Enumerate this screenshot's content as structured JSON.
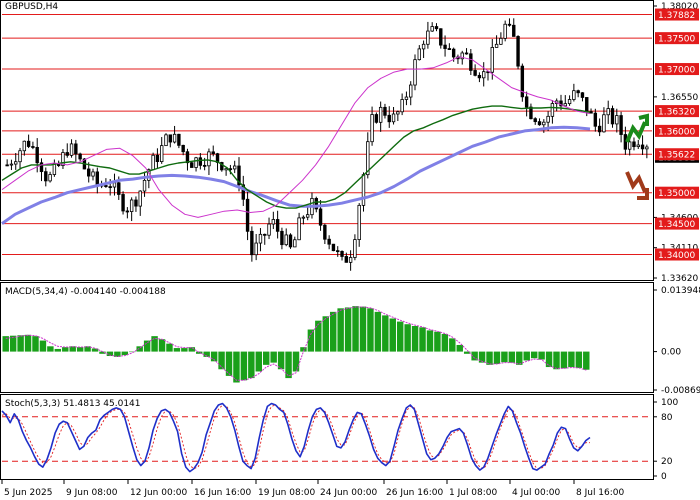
{
  "window": {
    "title": "GBPUSD,H4"
  },
  "colors": {
    "level_line": "#e31b1b",
    "price_tag": "#e31b1b",
    "current_tag": "#000000",
    "candle": "#000000",
    "ma_green": "#0f6b0f",
    "ma_purple": "#8080e6",
    "ma_magenta": "#cc33cc",
    "macd_bar": "#1aa01a",
    "macd_signal": "#cc33cc",
    "stoch_main": "#1f2fc9",
    "stoch_signal": "#e31b1b",
    "arrow_up": "#1a8a1a",
    "arrow_down": "#a03a1a"
  },
  "icons": {
    "up": "up-arrow-icon",
    "down": "down-arrow-icon"
  },
  "chart_data": [
    {
      "type": "line",
      "name": "GBPUSD,H4",
      "y_ticks": [
        "1.38020",
        "1.37882",
        "1.37500",
        "1.37000",
        "1.36550",
        "1.36320",
        "1.36000",
        "1.35581",
        "1.35622",
        "1.35000",
        "1.34600",
        "1.34500",
        "1.34110",
        "1.34000",
        "1.33620"
      ],
      "levels": [
        1.37882,
        1.375,
        1.37,
        1.3632,
        1.36,
        1.35622,
        1.35,
        1.345,
        1.34
      ],
      "current_price": "1.35581",
      "highlighted_levels": [
        "1.37882",
        "1.37500",
        "1.37000",
        "1.36320",
        "1.36000",
        "1.35622",
        "1.35000",
        "1.34500",
        "1.34000"
      ],
      "ylim": [
        1.3362,
        1.3802
      ],
      "close": [
        1.3545,
        1.3565,
        1.3585,
        1.356,
        1.352,
        1.354,
        1.3575,
        1.3555,
        1.353,
        1.351,
        1.352,
        1.349,
        1.3475,
        1.35,
        1.354,
        1.3565,
        1.3595,
        1.3575,
        1.355,
        1.3555,
        1.356,
        1.355,
        1.354,
        1.352,
        1.34,
        1.342,
        1.3455,
        1.343,
        1.3405,
        1.346,
        1.348,
        1.3445,
        1.3415,
        1.3385,
        1.341,
        1.352,
        1.362,
        1.3635,
        1.3618,
        1.364,
        1.37,
        1.375,
        1.376,
        1.374,
        1.372,
        1.3725,
        1.3705,
        1.369,
        1.373,
        1.377,
        1.3745,
        1.364,
        1.3625,
        1.3615,
        1.365,
        1.3645,
        1.366,
        1.364,
        1.3605,
        1.3625,
        1.3615,
        1.3575,
        1.359,
        1.3581
      ],
      "ma_green": [
        1.352,
        1.353,
        1.354,
        1.3545,
        1.3545,
        1.3545,
        1.3548,
        1.355,
        1.3548,
        1.3545,
        1.3542,
        1.354,
        1.3535,
        1.353,
        1.353,
        1.3535,
        1.354,
        1.3545,
        1.3548,
        1.355,
        1.3552,
        1.3553,
        1.355,
        1.354,
        1.352,
        1.3505,
        1.3495,
        1.3485,
        1.3478,
        1.3475,
        1.3475,
        1.348,
        1.3485,
        1.3485,
        1.349,
        1.35,
        1.3515,
        1.353,
        1.3545,
        1.356,
        1.3575,
        1.359,
        1.36,
        1.3605,
        1.3612,
        1.3618,
        1.3625,
        1.363,
        1.3635,
        1.3638,
        1.364,
        1.364,
        1.3638,
        1.3636,
        1.3637,
        1.3637,
        1.3638,
        1.3637,
        1.3635,
        1.3633,
        1.363
      ],
      "ma_purple": [
        1.345,
        1.3465,
        1.3475,
        1.3485,
        1.3492,
        1.35,
        1.3505,
        1.351,
        1.3515,
        1.352,
        1.3522,
        1.3525,
        1.3527,
        1.3528,
        1.3527,
        1.3525,
        1.3522,
        1.3518,
        1.351,
        1.3502,
        1.3495,
        1.3487,
        1.348,
        1.3478,
        1.3478,
        1.348,
        1.3483,
        1.3488,
        1.3493,
        1.35,
        1.351,
        1.3522,
        1.3535,
        1.3545,
        1.3555,
        1.3565,
        1.3575,
        1.3582,
        1.359,
        1.3595,
        1.36,
        1.3602,
        1.3605,
        1.3606,
        1.3605,
        1.3603
      ],
      "ma_magenta": [
        1.3505,
        1.352,
        1.3535,
        1.3545,
        1.3548,
        1.3545,
        1.355,
        1.356,
        1.357,
        1.3572,
        1.356,
        1.354,
        1.3505,
        1.348,
        1.3465,
        1.346,
        1.3465,
        1.347,
        1.3472,
        1.3468,
        1.347,
        1.348,
        1.35,
        1.352,
        1.3545,
        1.3575,
        1.361,
        1.3645,
        1.367,
        1.3685,
        1.3695,
        1.37,
        1.37,
        1.3702,
        1.371,
        1.372,
        1.3715,
        1.37,
        1.3685,
        1.367,
        1.3662,
        1.3655,
        1.365,
        1.364,
        1.3632,
        1.3628
      ]
    },
    {
      "type": "bar",
      "name": "MACD(5,34,4)",
      "values_label": "-0.004140 -0.004188",
      "y_ticks": [
        "0.013948",
        "0.00",
        "-0.008695"
      ],
      "ylim": [
        -0.008695,
        0.013948
      ],
      "values": [
        0.0035,
        0.0036,
        0.0037,
        0.0038,
        0.0035,
        0.0025,
        0.0012,
        0.0006,
        0.001,
        0.0012,
        0.001,
        0.0012,
        0.0007,
        -0.0005,
        -0.001,
        -0.0012,
        -0.0008,
        0.0,
        0.0012,
        0.0025,
        0.0035,
        0.0028,
        0.0018,
        0.0008,
        0.0008,
        0.001,
        -0.0005,
        -0.0012,
        -0.0022,
        -0.004,
        -0.0055,
        -0.007,
        -0.0065,
        -0.006,
        -0.0045,
        -0.003,
        -0.0025,
        -0.004,
        -0.006,
        -0.0045,
        0.001,
        0.005,
        0.007,
        0.008,
        0.009,
        0.0098,
        0.01,
        0.0103,
        0.0102,
        0.0098,
        0.009,
        0.0082,
        0.0075,
        0.0068,
        0.0062,
        0.0058,
        0.0055,
        0.0048,
        0.0045,
        0.004,
        0.003,
        0.0015,
        -0.0005,
        -0.002,
        -0.0025,
        -0.003,
        -0.0028,
        -0.0024,
        -0.0025,
        -0.003,
        -0.002,
        -0.0015,
        -0.0018,
        -0.0035,
        -0.004,
        -0.0038,
        -0.0035,
        -0.0037,
        -0.0041
      ],
      "signal": [
        0.003,
        0.0032,
        0.0035,
        0.0037,
        0.0036,
        0.003,
        0.002,
        0.0012,
        0.001,
        0.0011,
        0.001,
        0.0011,
        0.0008,
        0.0,
        -0.0008,
        -0.0011,
        -0.0009,
        -0.0003,
        0.0008,
        0.002,
        0.003,
        0.0028,
        0.002,
        0.0011,
        0.0009,
        0.0009,
        -0.0002,
        -0.001,
        -0.0018,
        -0.0035,
        -0.005,
        -0.0065,
        -0.0065,
        -0.006,
        -0.005,
        -0.0035,
        -0.0028,
        -0.0038,
        -0.0055,
        -0.0048,
        0.0,
        0.004,
        0.0062,
        0.0075,
        0.0085,
        0.0094,
        0.0098,
        0.0101,
        0.0101,
        0.0099,
        0.0093,
        0.0085,
        0.0078,
        0.0071,
        0.0065,
        0.006,
        0.0056,
        0.005,
        0.0046,
        0.0041,
        0.0033,
        0.002,
        0.0003,
        -0.0015,
        -0.0022,
        -0.0028,
        -0.0028,
        -0.0025,
        -0.0025,
        -0.0028,
        -0.0022,
        -0.0017,
        -0.0018,
        -0.0032,
        -0.0038,
        -0.0038,
        -0.0036,
        -0.0037,
        -0.0042
      ]
    },
    {
      "type": "line",
      "name": "Stoch(5,3,3)",
      "values_label": "51.4813 45.0141",
      "y_ticks": [
        "100",
        "80",
        "20",
        "0"
      ],
      "levels": [
        80,
        20
      ],
      "ylim": [
        0,
        100
      ],
      "main": [
        88,
        82,
        72,
        84,
        76,
        60,
        48,
        38,
        26,
        16,
        12,
        22,
        38,
        58,
        70,
        74,
        72,
        60,
        48,
        36,
        40,
        52,
        58,
        62,
        76,
        82,
        86,
        90,
        92,
        90,
        80,
        60,
        40,
        22,
        14,
        20,
        38,
        62,
        78,
        88,
        90,
        86,
        74,
        60,
        30,
        12,
        6,
        10,
        18,
        32,
        56,
        72,
        88,
        96,
        98,
        92,
        80,
        62,
        40,
        20,
        14,
        10,
        24,
        52,
        76,
        94,
        98,
        96,
        90,
        86,
        70,
        50,
        34,
        26,
        40,
        62,
        80,
        90,
        92,
        86,
        72,
        56,
        40,
        38,
        46,
        62,
        76,
        86,
        84,
        70,
        54,
        36,
        24,
        18,
        14,
        20,
        40,
        62,
        78,
        92,
        96,
        90,
        70,
        50,
        30,
        22,
        24,
        30,
        40,
        52,
        60,
        62,
        64,
        58,
        42,
        24,
        14,
        8,
        12,
        24,
        40,
        56,
        70,
        84,
        94,
        88,
        72,
        58,
        40,
        24,
        10,
        8,
        12,
        16,
        30,
        42,
        58,
        66,
        64,
        50,
        38,
        34,
        40,
        48,
        52
      ],
      "signal": [
        82,
        84,
        78,
        78,
        78,
        70,
        58,
        46,
        34,
        24,
        18,
        18,
        26,
        40,
        56,
        68,
        72,
        68,
        58,
        46,
        40,
        44,
        52,
        58,
        66,
        76,
        84,
        88,
        90,
        90,
        86,
        74,
        56,
        38,
        24,
        18,
        26,
        44,
        64,
        80,
        88,
        88,
        82,
        70,
        50,
        28,
        14,
        10,
        12,
        22,
        40,
        60,
        78,
        90,
        96,
        94,
        86,
        72,
        52,
        32,
        18,
        12,
        16,
        36,
        62,
        84,
        94,
        96,
        92,
        88,
        78,
        60,
        44,
        32,
        34,
        50,
        70,
        84,
        90,
        88,
        80,
        66,
        50,
        42,
        42,
        54,
        70,
        82,
        86,
        78,
        62,
        44,
        30,
        22,
        18,
        18,
        30,
        52,
        72,
        88,
        94,
        92,
        80,
        60,
        42,
        28,
        24,
        28,
        36,
        46,
        56,
        60,
        62,
        60,
        50,
        34,
        20,
        12,
        10,
        18,
        32,
        48,
        64,
        78,
        90,
        90,
        80,
        64,
        48,
        32,
        18,
        10,
        10,
        14,
        24,
        36,
        50,
        62,
        64,
        56,
        44,
        38,
        40,
        45,
        45
      ]
    }
  ],
  "x_ticks": [
    "5 Jun 2025",
    "9 Jun 08:00",
    "12 Jun 00:00",
    "16 Jun 16:00",
    "19 Jun 08:00",
    "24 Jun 00:00",
    "26 Jun 16:00",
    "1 Jul 08:00",
    "4 Jul 00:00",
    "8 Jul 16:00"
  ]
}
